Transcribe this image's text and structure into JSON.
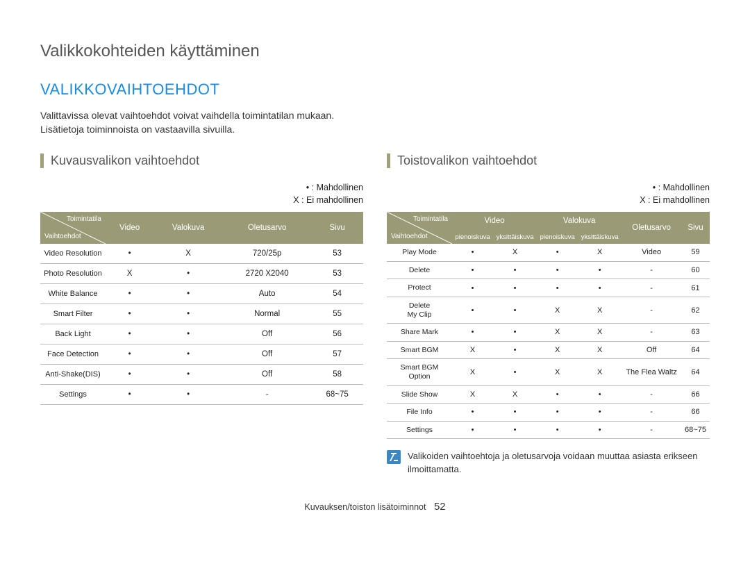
{
  "page_title": "Valikkokohteiden käyttäminen",
  "section_heading": "VALIKKOVAIHTOEHDOT",
  "intro_line1": "Valittavissa olevat vaihtoehdot voivat vaihdella toimintatilan mukaan.",
  "intro_line2": "Lisätietoja toiminnoista on vastaavilla sivuilla.",
  "legend_possible": "• : Mahdollinen",
  "legend_impossible": "X : Ei mahdollinen",
  "left": {
    "heading": "Kuvausvalikon vaihtoehdot",
    "header_diag_top": "Toimintatila",
    "header_diag_bot": "Vaihtoehdot",
    "cols": [
      "Video",
      "Valokuva",
      "Oletusarvo",
      "Sivu"
    ],
    "rows": [
      {
        "label": "Video Resolution",
        "video": "•",
        "valokuva": "X",
        "olet": "720/25p",
        "sivu": "53"
      },
      {
        "label": "Photo Resolution",
        "video": "X",
        "valokuva": "•",
        "olet": "2720 X2040",
        "sivu": "53"
      },
      {
        "label": "White Balance",
        "video": "•",
        "valokuva": "•",
        "olet": "Auto",
        "sivu": "54"
      },
      {
        "label": "Smart Filter",
        "video": "•",
        "valokuva": "•",
        "olet": "Normal",
        "sivu": "55"
      },
      {
        "label": "Back Light",
        "video": "•",
        "valokuva": "•",
        "olet": "Off",
        "sivu": "56"
      },
      {
        "label": "Face Detection",
        "video": "•",
        "valokuva": "•",
        "olet": "Off",
        "sivu": "57"
      },
      {
        "label": "Anti-Shake(DIS)",
        "video": "•",
        "valokuva": "•",
        "olet": "Off",
        "sivu": "58"
      },
      {
        "label": "Settings",
        "video": "•",
        "valokuva": "•",
        "olet": "-",
        "sivu": "68~75"
      }
    ]
  },
  "right": {
    "heading": "Toistovalikon vaihtoehdot",
    "header_diag_top": "Toimintatila",
    "header_diag_bot": "Vaihtoehdot",
    "group_cols": [
      "Video",
      "Valokuva"
    ],
    "sub_cols": [
      "pienoiskuva",
      "yksittäiskuva",
      "pienoiskuva",
      "yksittäiskuva"
    ],
    "tail_cols": [
      "Oletusarvo",
      "Sivu"
    ],
    "rows": [
      {
        "label": "Play Mode",
        "c": [
          "•",
          "X",
          "•",
          "X"
        ],
        "olet": "Video",
        "sivu": "59"
      },
      {
        "label": "Delete",
        "c": [
          "•",
          "•",
          "•",
          "•"
        ],
        "olet": "-",
        "sivu": "60"
      },
      {
        "label": "Protect",
        "c": [
          "•",
          "•",
          "•",
          "•"
        ],
        "olet": "-",
        "sivu": "61"
      },
      {
        "label": "Delete\nMy Clip",
        "c": [
          "•",
          "•",
          "X",
          "X"
        ],
        "olet": "-",
        "sivu": "62"
      },
      {
        "label": "Share Mark",
        "c": [
          "•",
          "•",
          "X",
          "X"
        ],
        "olet": "-",
        "sivu": "63"
      },
      {
        "label": "Smart BGM",
        "c": [
          "X",
          "•",
          "X",
          "X"
        ],
        "olet": "Off",
        "sivu": "64"
      },
      {
        "label": "Smart BGM\nOption",
        "c": [
          "X",
          "•",
          "X",
          "X"
        ],
        "olet": "The Flea Waltz",
        "sivu": "64"
      },
      {
        "label": "Slide Show",
        "c": [
          "X",
          "X",
          "•",
          "•"
        ],
        "olet": "-",
        "sivu": "66"
      },
      {
        "label": "File Info",
        "c": [
          "•",
          "•",
          "•",
          "•"
        ],
        "olet": "-",
        "sivu": "66"
      },
      {
        "label": "Settings",
        "c": [
          "•",
          "•",
          "•",
          "•"
        ],
        "olet": "-",
        "sivu": "68~75"
      }
    ]
  },
  "note_text": "Valikoiden vaihtoehtoja ja oletusarvoja voidaan muuttaa asiasta erikseen ilmoittamatta.",
  "footer_text": "Kuvauksen/toiston lisätoiminnot",
  "footer_page": "52"
}
